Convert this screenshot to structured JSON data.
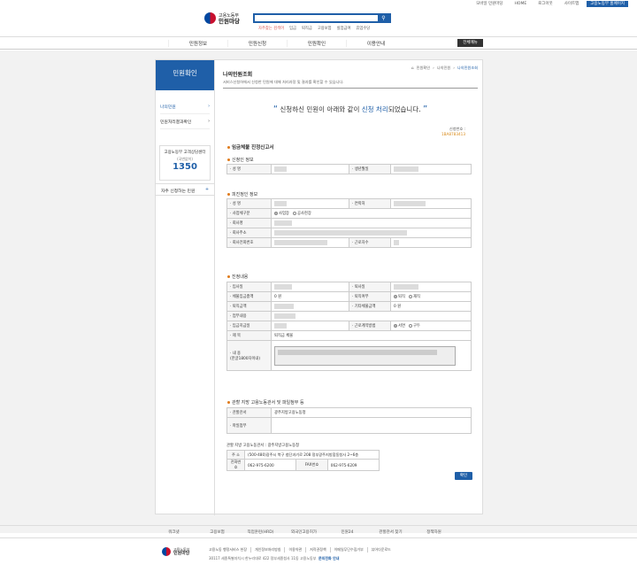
{
  "topbar": {
    "links": [
      "모바일 민원마당",
      "HOME",
      "로그아웃",
      "사이트맵",
      "고용노동부 홈페이지"
    ]
  },
  "header": {
    "org": "고용노동부",
    "site": "민원마당",
    "search_placeholder": "",
    "keywords_hot": "자주찾는 검색어",
    "keywords": [
      "임금",
      "퇴직금",
      "고용보험",
      "실업급여",
      "휴업수당"
    ]
  },
  "gnb": {
    "items": [
      "민원정보",
      "민원신청",
      "민원확인",
      "이용안내"
    ],
    "allmenu": "전체메뉴"
  },
  "lnb": {
    "title": "민원확인",
    "menu": [
      "나의민원",
      "민원처리결과확인"
    ],
    "call_l1": "고용노동부 고객상담센터",
    "call_l2": "(국번없이)",
    "call_no": "1350",
    "quick": "자주 신청하는 민원"
  },
  "content": {
    "title": "나의민원조회",
    "desc": "서비스신청하에서 신청한 민원에 대해 처리과정 및 결과를 확인할 수 있습니다.",
    "breadcrumb": [
      "민원확인",
      "나의민원",
      "나의민원조회"
    ],
    "done_pre": "신청하신 민원이 아래와 같이 ",
    "done_hl": "신청 처리",
    "done_post": "되었습니다.",
    "appno_label": "신청번호 :",
    "appno_value": "1BA8783413",
    "form_title": "임금체불 진정신고서",
    "sec_applicant": "신청인 정보",
    "sec_respondent": "피진정인 정보",
    "sec_content": "진정내용",
    "sec_office": "관할 지방 고용노동관서 및 파일첨부 등"
  },
  "applicant": {
    "name_label": "성 명",
    "birth_label": "생년월일"
  },
  "respondent": {
    "name_label": "성 명",
    "contact_label": "연락처",
    "biz_label": "사업체구분",
    "biz_opt1": "사업장",
    "biz_opt2": "공사현장",
    "company_label": "회사명",
    "addr_label": "회사주소",
    "phone_label": "회사전화번호",
    "workers_label": "근로자수"
  },
  "claim": {
    "join_label": "입사일",
    "leave_label": "퇴사일",
    "unpaid_label": "체불임금총액",
    "unpaid_value": "0 원",
    "retired_label": "퇴직여부",
    "retired_opt1": "퇴직",
    "retired_opt2": "재직",
    "severance_label": "퇴직금액",
    "other_label": "기타체불금액",
    "other_value": "0 원",
    "job_label": "업무내용",
    "payday_label": "임금지급일",
    "contract_label": "근로계약방법",
    "contract_opt1": "서면",
    "contract_opt2": "구두",
    "subject_label": "제 목",
    "subject_value": "퇴직금 체불",
    "body_label": "내 용",
    "body_sub": "(한글1800자이내)"
  },
  "office": {
    "office_label": "관할관서",
    "office_value": "광주지방고용노동청",
    "file_label": "파일첨부"
  },
  "gov": {
    "title": "관할 지방 고용노동관서 : 광주지방고용노동청",
    "addr_label": "주 소",
    "addr_value": "(500-480)광주시 북구 첨단과기로 208 정부광주지방합동청사 2~6층",
    "tel_label": "전화번호",
    "tel_value": "062-975-6200",
    "fax_label": "FAX번호",
    "fax_value": "062-975-6209"
  },
  "ok_button": "확인",
  "footer_nav": [
    "워크넷",
    "고용보험",
    "직업훈련(HRD)",
    "외국인고용허가",
    "민원24",
    "관할관서 찾기",
    "정책자원"
  ],
  "footer": {
    "org": "고용노동부",
    "site": "민원마당",
    "links": [
      "고용노동 행정서비스 헌장",
      "개인정보처리방침",
      "이용약관",
      "저작권정책",
      "이메일무단수집거부",
      "뷰어다운로드"
    ],
    "address": "30117 세종특별자치시 한누리대로 422 정부세종청사 11동 고용노동부",
    "call": "문의전화 안내"
  },
  "colors": {
    "accent": "#1f5fa8",
    "bullet": "#e07a1a"
  }
}
